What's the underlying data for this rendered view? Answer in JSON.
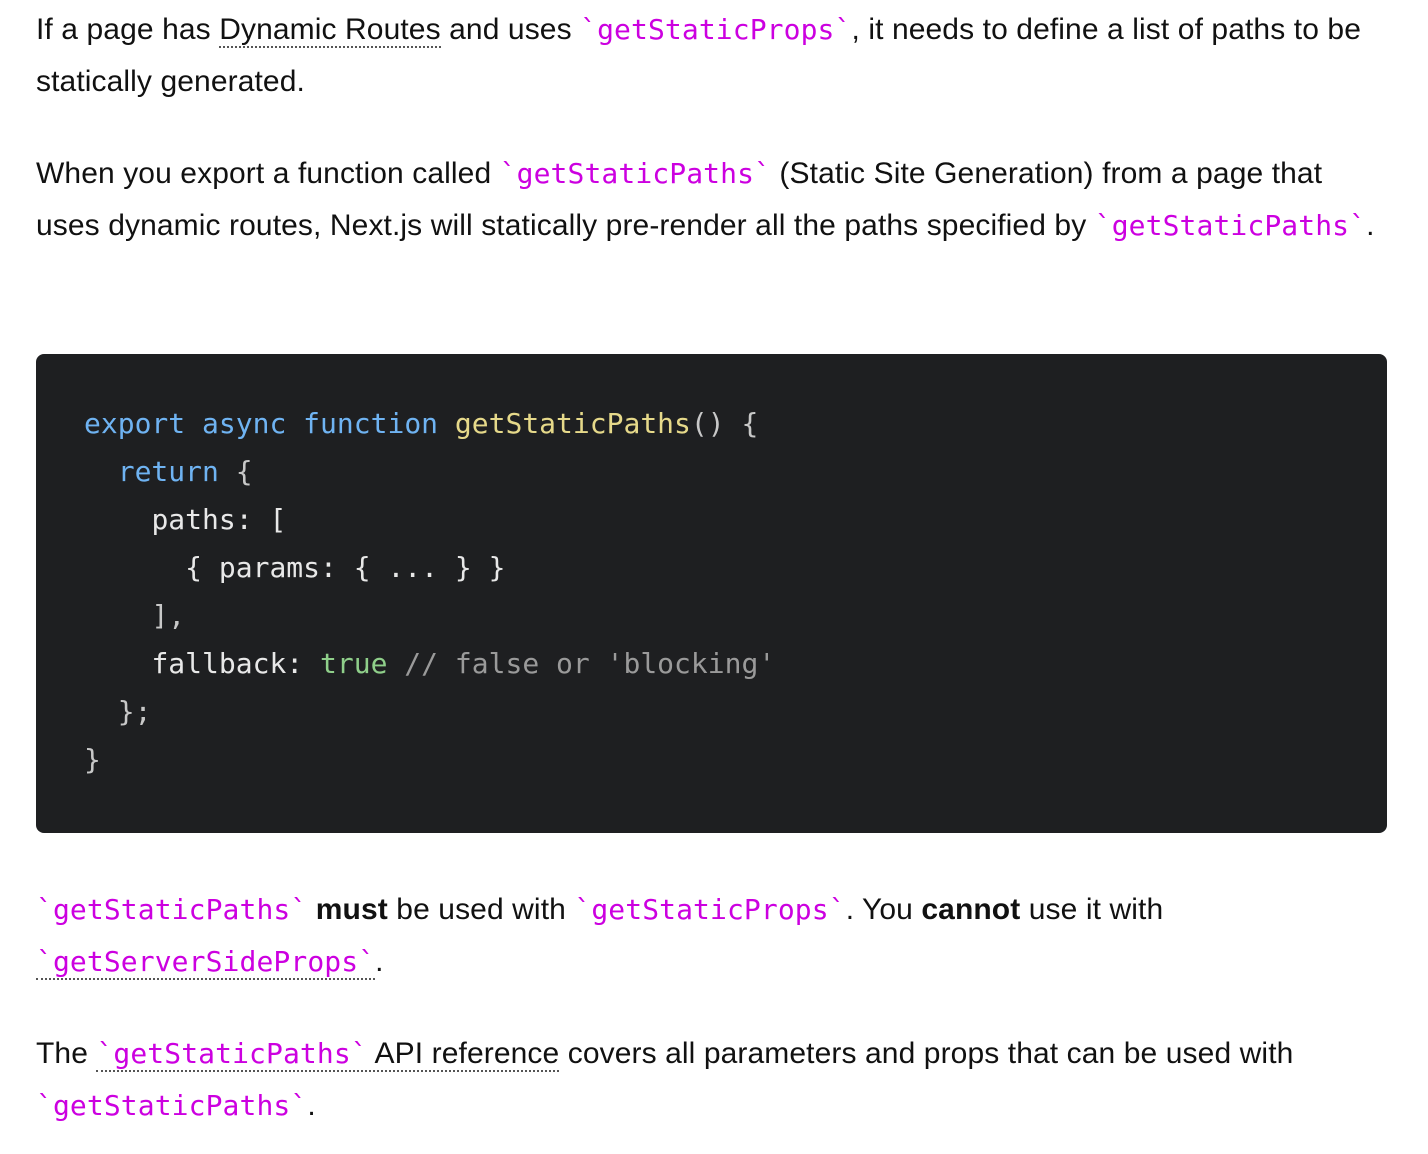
{
  "para1": {
    "t1": "If a page has ",
    "link_dynamic_routes": "Dynamic Routes",
    "t2": " and uses ",
    "code_getStaticProps": "`getStaticProps`",
    "t3": ", it needs to define a list of paths to be statically generated."
  },
  "para2": {
    "t1": "When you export a function called ",
    "code_getStaticPaths": "`getStaticPaths`",
    "t2": " (Static Site Generation) from a page that uses dynamic routes, Next.js will statically pre-render all the paths specified by ",
    "code_getStaticPaths_2": "`getStaticPaths`",
    "t3": "."
  },
  "code": {
    "l1_export": "export",
    "l1_async": "async",
    "l1_function": "function",
    "l1_name": "getStaticPaths",
    "l1_rest": "() {",
    "l2_return": "return",
    "l2_rest": " {",
    "l3": "paths: [",
    "l4": "{ params: { ... } }",
    "l5": "],",
    "l6_key": "fallback: ",
    "l6_true": "true",
    "l6_comment": " // false or 'blocking'",
    "l7": "};",
    "l8": "}"
  },
  "para3": {
    "code_getStaticPaths": "`getStaticPaths`",
    "t_must": "must",
    "t1": " be used with ",
    "code_getStaticProps": "`getStaticProps`",
    "t2": ". You ",
    "t_cannot": "cannot",
    "t3": " use it with ",
    "link_getServerSideProps": "`getServerSideProps`",
    "t4": "."
  },
  "para4": {
    "t1": "The ",
    "link_code": "`getStaticPaths`",
    "link_text": " API reference",
    "t2": " covers all parameters and props that can be used with ",
    "code_getStaticPaths": "`getStaticPaths`",
    "t3": "."
  },
  "colors": {
    "inline_code": "#cc00e0",
    "code_bg": "#1e1f21",
    "keyword": "#6fb3f2",
    "function_name": "#e6d98a",
    "boolean": "#8fcf8a",
    "comment": "#9a9a9a"
  }
}
